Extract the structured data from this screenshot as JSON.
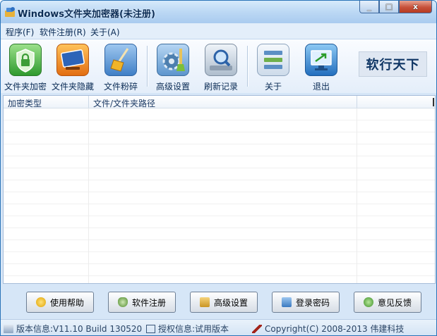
{
  "window": {
    "title": "Windows文件夹加密器(未注册)",
    "controls": [
      "_",
      "□",
      "x"
    ]
  },
  "menu": [
    {
      "label": "程序(F)"
    },
    {
      "label": "软件注册(R)"
    },
    {
      "label": "关于(A)"
    }
  ],
  "toolbar": [
    {
      "label": "文件夹加密",
      "icon": "lock-shield-icon"
    },
    {
      "label": "文件夹隐藏",
      "icon": "monitor-hide-icon"
    },
    {
      "label": "文件粉碎",
      "icon": "broom-icon"
    },
    {
      "label": "高级设置",
      "icon": "gear-broom-icon"
    },
    {
      "label": "刷新记录",
      "icon": "magnifier-refresh-icon"
    },
    {
      "label": "关于",
      "icon": "info-list-icon"
    },
    {
      "label": "退出",
      "icon": "exit-monitor-icon"
    }
  ],
  "brand": "软行天下",
  "list": {
    "columns": [
      "加密类型",
      "文件/文件夹路径",
      ""
    ]
  },
  "buttons": [
    {
      "label": "使用帮助",
      "icon": "help-icon"
    },
    {
      "label": "软件注册",
      "icon": "money-bag-icon"
    },
    {
      "label": "高级设置",
      "icon": "settings-icon"
    },
    {
      "label": "登录密码",
      "icon": "login-key-icon"
    },
    {
      "label": "意见反馈",
      "icon": "feedback-icon"
    }
  ],
  "status": {
    "version": "版本信息:V11.10 Build 130520",
    "license": "授权信息:试用版本",
    "copyright": "Copyright(C) 2008-2013 伟建科技"
  }
}
